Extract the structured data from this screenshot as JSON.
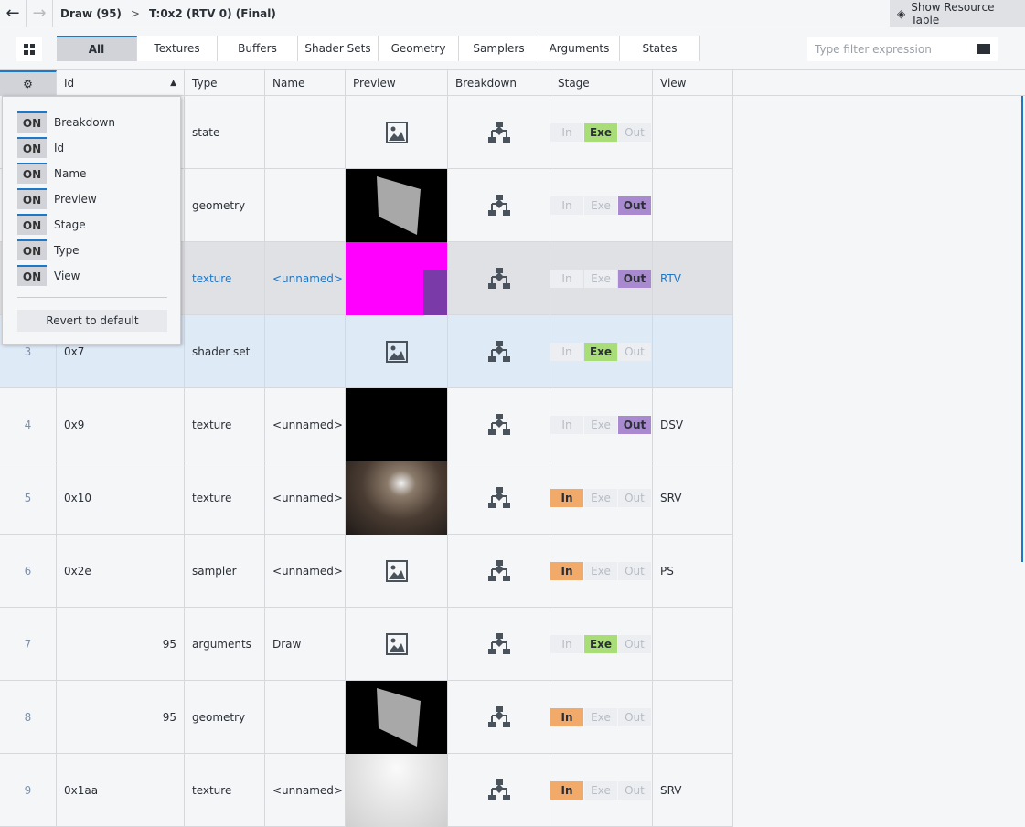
{
  "header": {
    "back": "←",
    "forward": "→",
    "crumb1": "Draw (95)",
    "sep": ">",
    "crumb2": "T:0x2 (RTV 0) (Final)",
    "show_resource_table": "Show Resource Table"
  },
  "tabs": [
    "All",
    "Textures",
    "Buffers",
    "Shader Sets",
    "Geometry",
    "Samplers",
    "Arguments",
    "States"
  ],
  "filter_placeholder": "Type filter expression",
  "columns": [
    "Id",
    "Type",
    "Name",
    "Preview",
    "Breakdown",
    "Stage",
    "View"
  ],
  "sort_indicator": "▲",
  "stage_labels": [
    "In",
    "Exe",
    "Out"
  ],
  "rows": [
    {
      "idx": "",
      "id": "",
      "type": "state",
      "name": "",
      "preview": "icon",
      "stage": "Exe",
      "view": ""
    },
    {
      "idx": "",
      "id": "",
      "type": "geometry",
      "name": "",
      "preview": "geom",
      "stage": "Out",
      "view": ""
    },
    {
      "idx": "",
      "id": "",
      "type": "texture",
      "name": "<unnamed>",
      "preview": "magenta",
      "stage": "Out",
      "view": "RTV"
    },
    {
      "idx": "3",
      "id": "0x7",
      "type": "shader set",
      "name": "",
      "preview": "icon",
      "stage": "Exe",
      "view": ""
    },
    {
      "idx": "4",
      "id": "0x9",
      "type": "texture",
      "name": "<unnamed>",
      "preview": "black",
      "stage": "Out",
      "view": "DSV"
    },
    {
      "idx": "5",
      "id": "0x10",
      "type": "texture",
      "name": "<unnamed>",
      "preview": "scene",
      "stage": "In",
      "view": "SRV"
    },
    {
      "idx": "6",
      "id": "0x2e",
      "type": "sampler",
      "name": "<unnamed>",
      "preview": "icon",
      "stage": "In",
      "view": "PS"
    },
    {
      "idx": "7",
      "id": "95",
      "type": "arguments",
      "name": "Draw",
      "preview": "icon",
      "stage": "Exe",
      "view": ""
    },
    {
      "idx": "8",
      "id": "95",
      "type": "geometry",
      "name": "",
      "preview": "geom",
      "stage": "In",
      "view": ""
    },
    {
      "idx": "9",
      "id": "0x1aa",
      "type": "texture",
      "name": "<unnamed>",
      "preview": "white",
      "stage": "In",
      "view": "SRV"
    }
  ],
  "popup": {
    "on_label": "ON",
    "options": [
      "Breakdown",
      "Id",
      "Name",
      "Preview",
      "Stage",
      "Type",
      "View"
    ],
    "revert": "Revert to default"
  }
}
